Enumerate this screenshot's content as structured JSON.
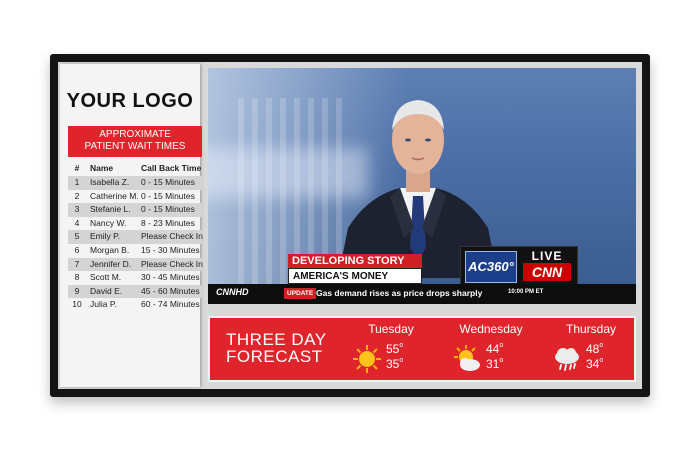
{
  "logo_text": "YOUR LOGO",
  "wait_panel": {
    "title_line1": "APPROXIMATE",
    "title_line2": "PATIENT WAIT TIMES",
    "headers": [
      "#",
      "Name",
      "Call Back Time"
    ],
    "rows": [
      [
        "1",
        "Isabella Z.",
        "0 - 15 Minutes"
      ],
      [
        "2",
        "Catherine M.",
        "0 - 15 Minutes"
      ],
      [
        "3",
        "Stefanie L.",
        "0 - 15 Minutes"
      ],
      [
        "4",
        "Nancy W.",
        "8 - 23 Minutes"
      ],
      [
        "5",
        "Emily P.",
        "Please Check In"
      ],
      [
        "6",
        "Morgan B.",
        "15 - 30 Minutes"
      ],
      [
        "7",
        "Jennifer D.",
        "Please Check In"
      ],
      [
        "8",
        "Scott M.",
        "30 - 45 Minutes"
      ],
      [
        "9",
        "David E.",
        "45 - 60 Minutes"
      ],
      [
        "10",
        "Julia P.",
        "60 - 74 Minutes"
      ]
    ]
  },
  "news": {
    "headline_top": "DEVELOPING STORY",
    "headline_bottom": "AMERICA'S MONEY CRISIS",
    "bug_show": "AC360°",
    "bug_live": "LIVE",
    "bug_network": "CNN",
    "ticker_logo": "CNNHD",
    "ticker_tag": "UPDATE",
    "ticker_text": "Gas demand rises as price drops sharply",
    "ticker_time": "10:00 PM ET"
  },
  "forecast": {
    "title_line1": "THREE DAY",
    "title_line2": "FORECAST",
    "days": [
      {
        "name": "Tuesday",
        "hi": "55",
        "lo": "35",
        "icon": "sun-icon"
      },
      {
        "name": "Wednesday",
        "hi": "44",
        "lo": "31",
        "icon": "partly-cloudy-icon"
      },
      {
        "name": "Thursday",
        "hi": "48",
        "lo": "34",
        "icon": "rain-cloud-icon"
      }
    ],
    "degree_symbol": "o"
  },
  "colors": {
    "accent_red": "#e0242b",
    "frame": "#141414"
  }
}
